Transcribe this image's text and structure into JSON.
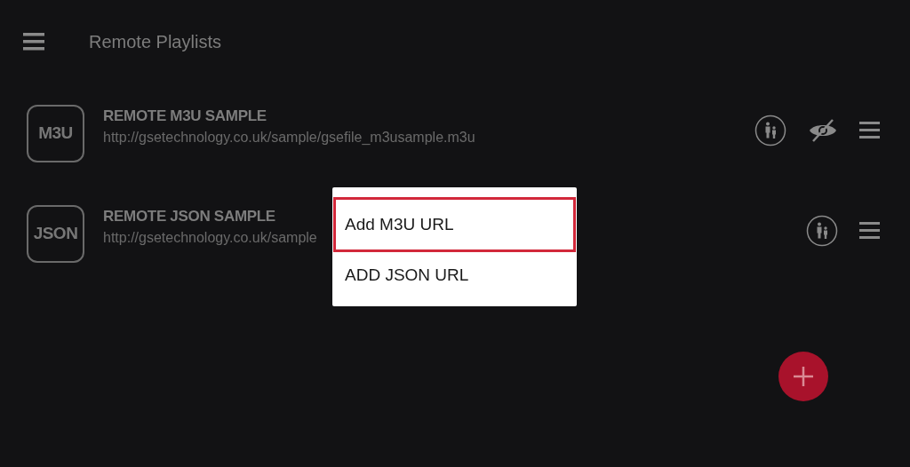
{
  "app_bar": {
    "title": "Remote Playlists"
  },
  "playlists": [
    {
      "badge": "M3U",
      "title": "REMOTE M3U SAMPLE",
      "url": "http://gsetechnology.co.uk/sample/gsefile_m3usample.m3u",
      "hidden": true
    },
    {
      "badge": "JSON",
      "title": "REMOTE JSON SAMPLE",
      "url": "http://gsetechnology.co.uk/sample",
      "hidden": false
    }
  ],
  "popup_menu": [
    {
      "label": "Add M3U URL",
      "selected": true
    },
    {
      "label": "ADD JSON URL",
      "selected": false
    }
  ]
}
